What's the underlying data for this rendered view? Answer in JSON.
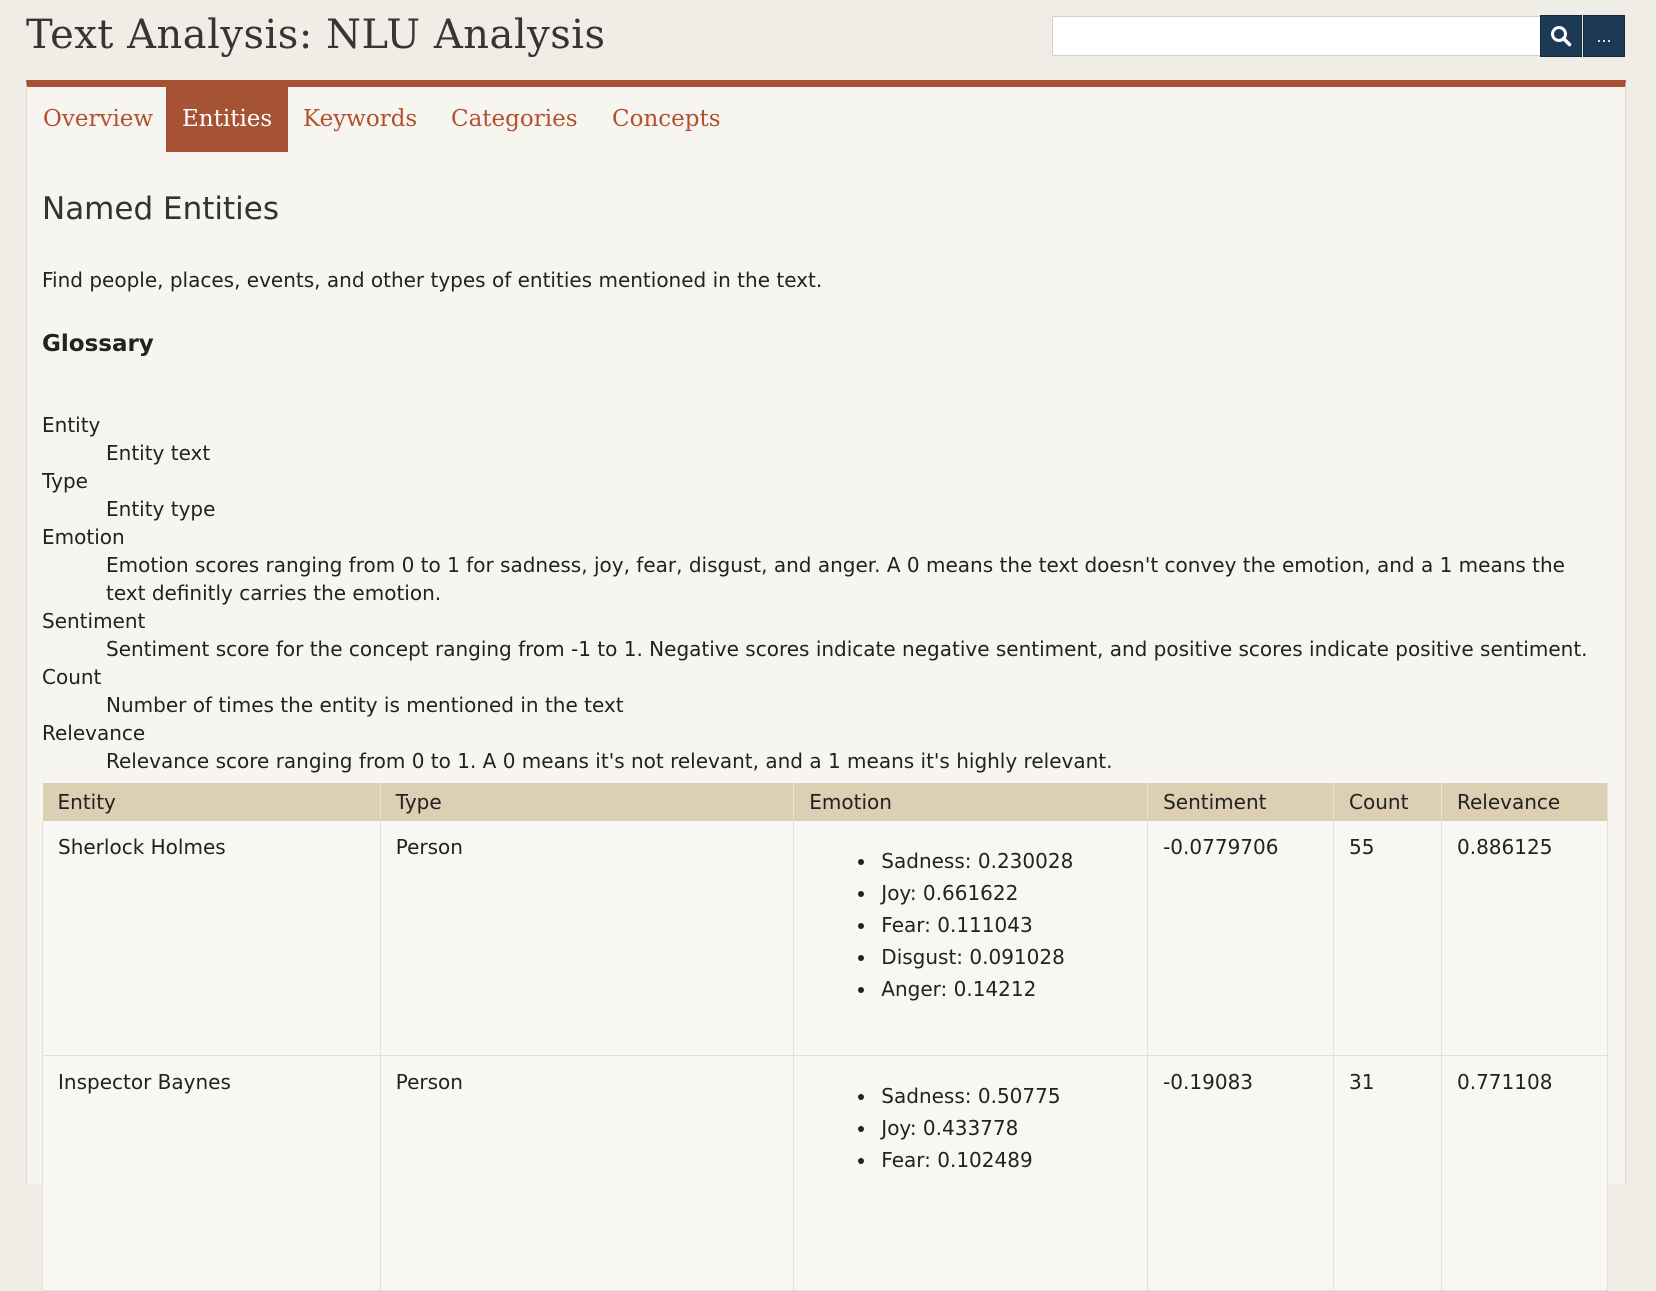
{
  "header": {
    "title": "Text Analysis: NLU Analysis",
    "search_placeholder": "",
    "more_label": "..."
  },
  "tabs": [
    {
      "label": "Overview",
      "active": false
    },
    {
      "label": "Entities",
      "active": true
    },
    {
      "label": "Keywords",
      "active": false
    },
    {
      "label": "Categories",
      "active": false
    },
    {
      "label": "Concepts",
      "active": false
    }
  ],
  "main": {
    "title": "Named Entities",
    "intro": "Find people, places, events, and other types of entities mentioned in the text.",
    "glossary_title": "Glossary",
    "glossary": [
      {
        "term": "Entity",
        "definition": "Entity text"
      },
      {
        "term": "Type",
        "definition": "Entity type"
      },
      {
        "term": "Emotion",
        "definition": "Emotion scores ranging from 0 to 1 for sadness, joy, fear, disgust, and anger. A 0 means the text doesn't convey the emotion, and a 1 means the text definitly carries the emotion."
      },
      {
        "term": "Sentiment",
        "definition": "Sentiment score for the concept ranging from -1 to 1. Negative scores indicate negative sentiment, and positive scores indicate positive sentiment."
      },
      {
        "term": "Count",
        "definition": "Number of times the entity is mentioned in the text"
      },
      {
        "term": "Relevance",
        "definition": "Relevance score ranging from 0 to 1. A 0 means it's not relevant, and a 1 means it's highly relevant."
      }
    ]
  },
  "table": {
    "headers": [
      "Entity",
      "Type",
      "Emotion",
      "Sentiment",
      "Count",
      "Relevance"
    ],
    "rows": [
      {
        "entity": "Sherlock Holmes",
        "type": "Person",
        "emotions": [
          "Sadness: 0.230028",
          "Joy: 0.661622",
          "Fear: 0.111043",
          "Disgust: 0.091028",
          "Anger: 0.14212"
        ],
        "sentiment": "-0.0779706",
        "count": "55",
        "relevance": "0.886125"
      },
      {
        "entity": "Inspector Baynes",
        "type": "Person",
        "emotions": [
          "Sadness: 0.50775",
          "Joy: 0.433778",
          "Fear: 0.102489"
        ],
        "sentiment": "-0.19083",
        "count": "31",
        "relevance": "0.771108"
      }
    ]
  },
  "colors": {
    "accent": "#a65234",
    "tab_text": "#b3512e",
    "button": "#1d3a55",
    "table_header": "#dccfb3",
    "background": "#efede6"
  },
  "icons": {
    "search": "search-icon"
  }
}
